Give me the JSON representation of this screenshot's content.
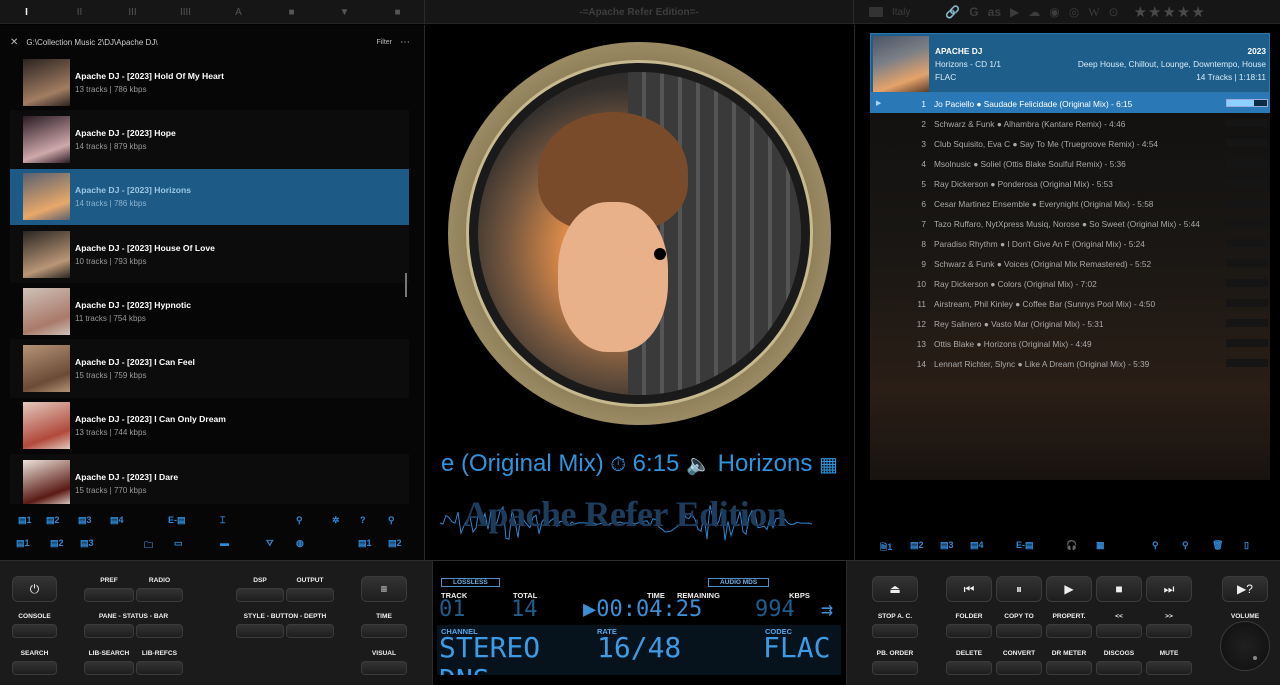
{
  "topbar": {
    "left_buttons": [
      "I",
      "II",
      "III",
      "IIII",
      "A",
      "■",
      "▼",
      "■"
    ],
    "center_title": "-=Apache Refer Edition=-",
    "language": "Italy",
    "right_icons": [
      "link-icon",
      "google-icon",
      "lastfm-icon",
      "youtube-icon",
      "soundcloud-icon",
      "spotify-icon",
      "discogs-icon",
      "wikipedia-icon",
      "podcast-icon"
    ],
    "rating_stars": "★★★★★"
  },
  "library": {
    "path": "G:\\Collection Music 2\\DJ\\Apache DJ\\",
    "filter_label": "Filter",
    "albums": [
      {
        "title": "Apache DJ - [2023] Hold Of My Heart",
        "sub": "13 tracks | 786 kbps",
        "c1": "#2b2321",
        "c2": "#a27d62"
      },
      {
        "title": "Apache DJ - [2023] Hope",
        "sub": "14 tracks | 879 kbps",
        "c1": "#2a1a24",
        "c2": "#cfa9ac"
      },
      {
        "title": "Apache DJ - [2023] Horizons",
        "sub": "14 tracks | 786 kbps",
        "c1": "#5a6070",
        "c2": "#e8a86a"
      },
      {
        "title": "Apache DJ - [2023] House Of Love",
        "sub": "10 tracks | 793 kbps",
        "c1": "#2a2622",
        "c2": "#b99677"
      },
      {
        "title": "Apache DJ - [2023] Hypnotic",
        "sub": "11 tracks | 754 kbps",
        "c1": "#cfc1b8",
        "c2": "#a97a6a"
      },
      {
        "title": "Apache DJ - [2023] I Can Feel",
        "sub": "15 tracks | 759 kbps",
        "c1": "#b59377",
        "c2": "#6b4b37"
      },
      {
        "title": "Apache DJ - [2023] I Can Only Dream",
        "sub": "13 tracks | 744 kbps",
        "c1": "#e3c9bd",
        "c2": "#b1493c"
      },
      {
        "title": "Apache DJ - [2023] I Dare",
        "sub": "15 tracks | 770 kbps",
        "c1": "#ece2da",
        "c2": "#5a1a14"
      }
    ],
    "toolbar_row1": [
      "▤1",
      "▤2",
      "▤3",
      "▤4",
      "E-▤",
      "⌶",
      "⚲",
      "✲",
      "?",
      "⚲"
    ],
    "toolbar_row2": [
      "▤1",
      "▤2",
      "▤3",
      "🗀",
      "▭",
      "▬",
      "⛛",
      "◍",
      "▤1",
      "▤2"
    ]
  },
  "center": {
    "ticker": [
      "e (Original Mix)",
      "⏱",
      "6:15",
      "🔈",
      "Horizons",
      "▦"
    ],
    "wave_title": "Apache Refer Edition"
  },
  "now_playing": {
    "artist": "APACHE DJ",
    "album": "Horizons - CD 1/1",
    "format": "FLAC",
    "year": "2023",
    "genres": "Deep House, Chillout, Lounge, Downtempo, House",
    "summary": "14 Tracks | 1:18:11"
  },
  "playlist": {
    "tracks": [
      {
        "n": "1",
        "title": "Jo Paciello ● Saudade Felicidade (Original Mix) - 6:15",
        "current": true
      },
      {
        "n": "2",
        "title": "Schwarz & Funk ● Alhambra (Kantare Remix) - 4:46"
      },
      {
        "n": "3",
        "title": "Club Squisito, Eva C ● Say To Me (Truegroove Remix) - 4:54"
      },
      {
        "n": "4",
        "title": "Msolnusic ● Soliel (Ottis Blake Soulful Remix) - 5:36"
      },
      {
        "n": "5",
        "title": "Ray Dickerson ● Ponderosa (Original Mix) - 5:53"
      },
      {
        "n": "6",
        "title": "Cesar Martinez Ensemble ● Everynight (Original Mix) - 5:58"
      },
      {
        "n": "7",
        "title": "Tazo Ruffaro, NytXpress Musiq, Norose ● So Sweet (Original Mix) - 5:44"
      },
      {
        "n": "8",
        "title": "Paradiso Rhythm ● I Don't Give An F (Original Mix) - 5:24"
      },
      {
        "n": "9",
        "title": "Schwarz & Funk ● Voices (Original Mix Remastered) - 5:52"
      },
      {
        "n": "10",
        "title": "Ray Dickerson ● Colors (Original Mix) - 7:02"
      },
      {
        "n": "11",
        "title": "Airstream, Phil Kinley ● Coffee Bar (Sunnys Pool Mix) - 4:50"
      },
      {
        "n": "12",
        "title": "Rey Salinero ● Vasto Mar (Original Mix) - 5:31"
      },
      {
        "n": "13",
        "title": "Ottis Blake ● Horizons (Original Mix) - 4:49"
      },
      {
        "n": "14",
        "title": "Lennart Richter, Slync ● Like A Dream (Original Mix) - 5:39"
      }
    ],
    "current_progress": 0.68,
    "toolbar": [
      "🗎1",
      "▤2",
      "▤3",
      "▤4",
      "E-▤",
      "🎧",
      "▦",
      "⚲",
      "⚲",
      "🗑",
      "▯"
    ]
  },
  "controls_left": {
    "power": "⏻",
    "pref": "PREF",
    "radio": "RADIO",
    "dsp": "DSP",
    "output": "OUTPUT",
    "console": "CONSOLE",
    "pane_status_bar": "PANE - STATUS - BAR",
    "style_button_depth": "STYLE - BUTTON - DEPTH",
    "time": "TIME",
    "search": "SEARCH",
    "lib_search": "LIB-SEARCH",
    "lib_refcs": "LIB-REFCS",
    "visual": "VISUAL",
    "menu": "≡"
  },
  "lcd": {
    "lossless": "LOSSLESS",
    "audio_mds": "AUDIO MDS",
    "h_track": "TRACK",
    "h_total": "TOTAL",
    "h_time": "TIME",
    "h_remaining": "REMAINING",
    "h_kbps": "KBPS",
    "track": "01",
    "total": "14",
    "time": "▶00:04:25",
    "kbps": "994",
    "arrows": "⇉",
    "h_channel": "CHANNEL",
    "h_rate": "RATE",
    "h_codec": "CODEC",
    "channel": "STEREO",
    "rate": "16/48",
    "codec": "FLAC",
    "channel2": "DNS"
  },
  "controls_right": {
    "eject": "⏏",
    "prev": "⏮",
    "pause": "⏸",
    "play": "▶",
    "stop": "■",
    "next": "⏭",
    "help": "▶?",
    "stop_ac": "STOP A. C.",
    "folder": "FOLDER",
    "copy_to": "COPY TO",
    "propert": "PROPERT.",
    "back": "<<",
    "fwd": ">>",
    "volume": "VOLUME",
    "pb_order": "PB. ORDER",
    "delete": "DELETE",
    "convert": "CONVERT",
    "dr_meter": "DR METER",
    "discogs": "DISCOGS",
    "mute": "MUTE"
  }
}
